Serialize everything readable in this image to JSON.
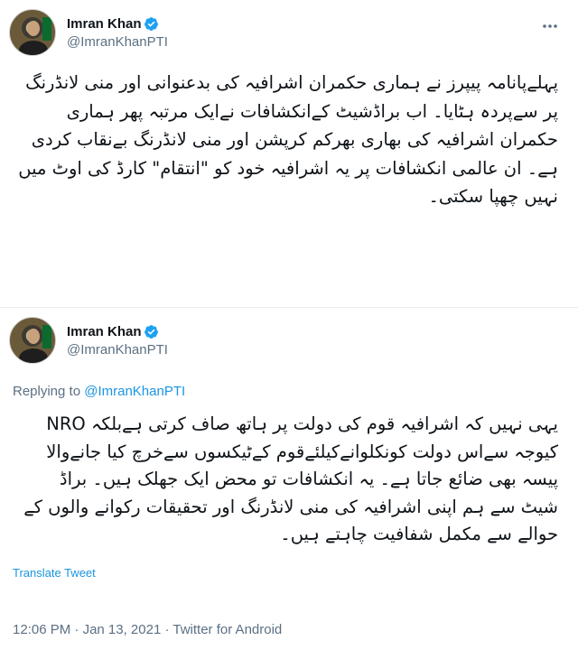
{
  "tweets": [
    {
      "author": {
        "name": "Imran Khan",
        "handle": "@ImranKhanPTI"
      },
      "text": "پہلےپانامہ پیپرز نے ہماری حکمران اشرافیہ کی بدعنوانی اور منی لانڈرنگ پر سےپردہ ہٹایا۔ اب براڈشیٹ کےانکشافات نےایک مرتبہ پھر ہماری حکمران اشرافیہ کی بھاری بھرکم کرپشن اور منی لانڈرنگ بےنقاب کردی ہے۔ ان عالمی انکشافات پر یہ اشرافیہ خود کو \"انتقام\" کارڈ کی اوٹ میں نہیں چھپا سکتی۔"
    },
    {
      "author": {
        "name": "Imran Khan",
        "handle": "@ImranKhanPTI"
      },
      "replying_label": "Replying to ",
      "replying_to": "@ImranKhanPTI",
      "text": "یہی نہیں کہ اشرافیہ قوم کی دولت پر ہاتھ صاف کرتی ہےبلکہ NRO کیوجہ سےاس دولت کونکلوانےکیلئےقوم کےٹیکسوں سےخرچ کیا جانےوالا پیسہ بھی ضائع جاتا ہے۔ یہ انکشافات تو محض ایک جھلک ہیں۔ براڈ شیٹ سے ہم اپنی اشرافیہ کی منی لانڈرنگ اور تحقیقات رکوانے والوں کے حوالے سے مکمل شفافیت چاہتے ہیں۔",
      "translate_label": "Translate Tweet",
      "time": "12:06 PM",
      "separator": " · ",
      "date": "Jan 13, 2021",
      "source": "Twitter for Android"
    }
  ],
  "icons": {
    "verified": "verified-badge-icon",
    "more": "more-options-icon"
  },
  "colors": {
    "link": "#1b95e0",
    "secondary": "#5b7083",
    "verified": "#1da1f2",
    "text": "#0f1419"
  }
}
